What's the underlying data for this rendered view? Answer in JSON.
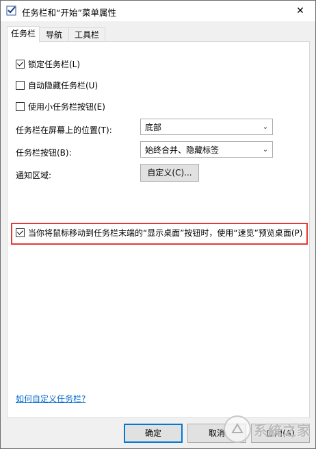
{
  "window": {
    "title": "任务栏和“开始”菜单属性",
    "close_glyph": "✕"
  },
  "tabs": [
    {
      "label": "任务栏",
      "active": true
    },
    {
      "label": "导航",
      "active": false
    },
    {
      "label": "工具栏",
      "active": false
    }
  ],
  "options": {
    "lock": {
      "label": "锁定任务栏(L)",
      "checked": true
    },
    "autohide": {
      "label": "自动隐藏任务栏(U)",
      "checked": false
    },
    "small_buttons": {
      "label": "使用小任务栏按钮(E)",
      "checked": false
    }
  },
  "position": {
    "label": "任务栏在屏幕上的位置(T):",
    "value": "底部"
  },
  "buttons_combine": {
    "label": "任务栏按钮(B):",
    "value": "始终合并、隐藏标签"
  },
  "notification": {
    "label": "通知区域:",
    "button": "自定义(C)..."
  },
  "peek": {
    "label": "当你将鼠标移动到任务栏末端的“显示桌面”按钮时，使用“速览”预览桌面(P)",
    "checked": true
  },
  "help_link": "如何自定义任务栏?",
  "footer": {
    "ok": "确定",
    "cancel": "取消",
    "apply": "应用(A)"
  },
  "watermark": "系统之家",
  "colors": {
    "highlight_border": "#e53935",
    "link": "#0066cc",
    "accent": "#0078d7"
  }
}
